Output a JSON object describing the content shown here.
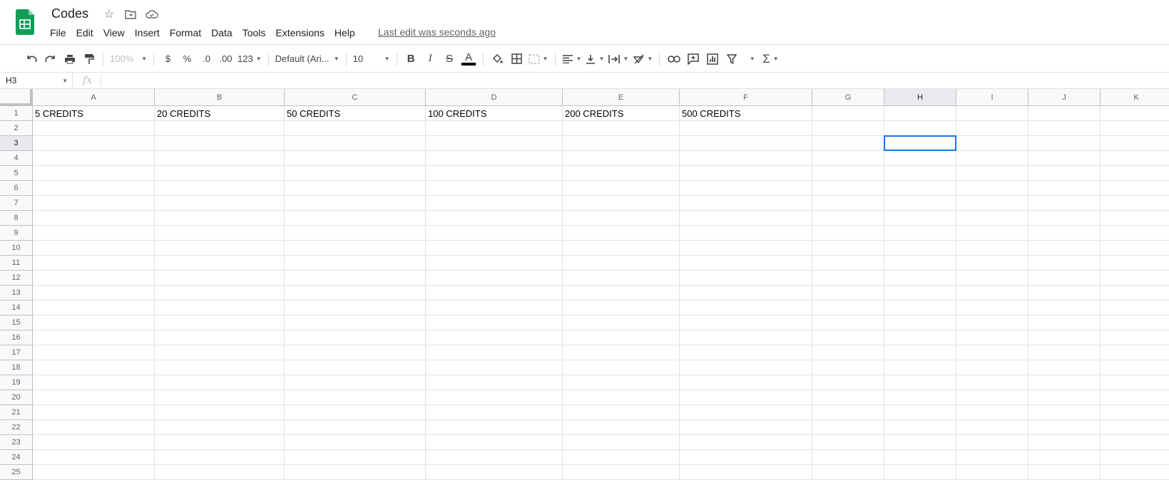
{
  "doc": {
    "title": "Codes",
    "last_edit": "Last edit was seconds ago"
  },
  "menu": [
    "File",
    "Edit",
    "View",
    "Insert",
    "Format",
    "Data",
    "Tools",
    "Extensions",
    "Help"
  ],
  "toolbar": {
    "zoom": "100%",
    "currency": "$",
    "percent": "%",
    "dec_less": ".0",
    "dec_more": ".00",
    "more_formats": "123",
    "font": "Default (Ari...",
    "font_size": "10",
    "bold": "B",
    "italic": "I",
    "strike": "S",
    "text_color": "A"
  },
  "formula_bar": {
    "name_box": "H3",
    "fx": "fx",
    "value": ""
  },
  "columns": [
    "A",
    "B",
    "C",
    "D",
    "E",
    "F",
    "G",
    "H",
    "I",
    "J",
    "K"
  ],
  "rows": [
    "1",
    "2",
    "3",
    "4",
    "5",
    "6",
    "7",
    "8",
    "9",
    "10",
    "11",
    "12",
    "13",
    "14",
    "15",
    "16",
    "17",
    "18",
    "19",
    "20",
    "21",
    "22",
    "23",
    "24",
    "25"
  ],
  "row1_cells": [
    "5 CREDITS",
    "20 CREDITS",
    "50 CREDITS",
    "100 CREDITS",
    "200 CREDITS",
    "500 CREDITS"
  ],
  "selected": {
    "col": "H",
    "row": "3"
  },
  "colors": {
    "accent": "#1a73e8",
    "sheets_green": "#0f9d58"
  }
}
